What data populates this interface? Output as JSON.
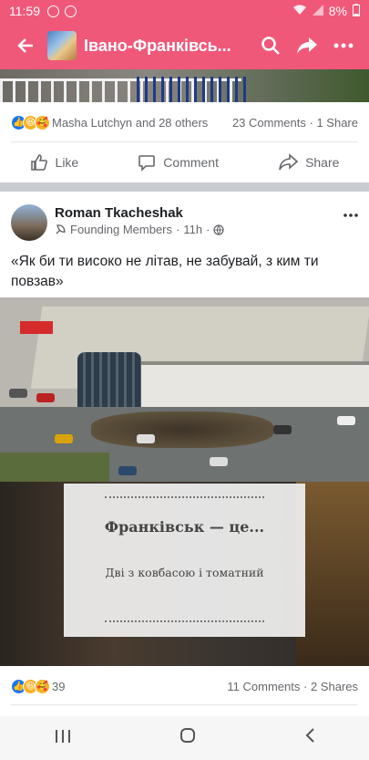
{
  "status_bar": {
    "time": "11:59",
    "battery": "8%"
  },
  "app_bar": {
    "title": "Івано-Франківсь..."
  },
  "prev_post": {
    "reactions_text": "Masha Lutchyn and 28 others",
    "comments": "23 Comments",
    "shares": "1 Share"
  },
  "actions": {
    "like": "Like",
    "comment": "Comment",
    "share": "Share"
  },
  "post": {
    "author": "Roman Tkacheshak",
    "badge": "Founding Members",
    "time": "11h",
    "text": "«Як би ти високо не літав, не забувай, з ким ти повзав»",
    "promo_title": "Франківськ — це...",
    "promo_sub": "Дві з ковбасою і томатний",
    "reactions_count": "39",
    "comments": "11 Comments",
    "shares": "2 Shares"
  },
  "colors": {
    "brand": "#f0587a",
    "like_blue": "#1877f2"
  }
}
